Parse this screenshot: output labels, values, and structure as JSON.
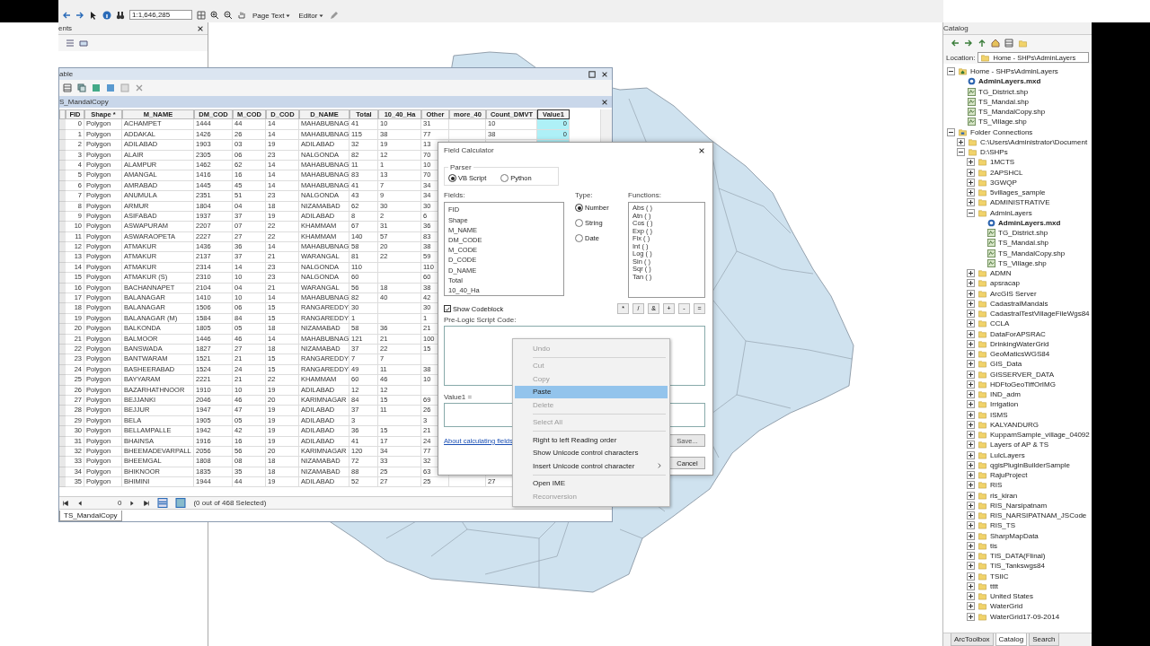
{
  "toolbar": {
    "scale": "1:1,646,285",
    "editor_menu": "Editor",
    "page_text_menu": "Page Text"
  },
  "toc": {
    "title": "ents"
  },
  "table_window": {
    "title": "able",
    "tab": "S_MandalCopy",
    "columns": [
      {
        "label": "FID",
        "selected": false
      },
      {
        "label": "Shape *",
        "selected": false
      },
      {
        "label": "M_NAME",
        "selected": false
      },
      {
        "label": "DM_COD",
        "selected": false
      },
      {
        "label": "M_COD",
        "selected": false
      },
      {
        "label": "D_COD",
        "selected": false
      },
      {
        "label": "D_NAME",
        "selected": false
      },
      {
        "label": "Total",
        "selected": false
      },
      {
        "label": "10_40_Ha",
        "selected": false
      },
      {
        "label": "Other",
        "selected": false
      },
      {
        "label": "more_40",
        "selected": false
      },
      {
        "label": "Count_DMVT",
        "selected": false
      },
      {
        "label": "Value1",
        "selected": true
      }
    ],
    "rows": [
      [
        "0",
        "Polygon",
        "ACHAMPET",
        "1444",
        "44",
        "14",
        "MAHABUBNAG",
        "41",
        "10",
        "31",
        null,
        "10",
        "0"
      ],
      [
        "1",
        "Polygon",
        "ADDAKAL",
        "1426",
        "26",
        "14",
        "MAHABUBNAG",
        "115",
        "38",
        "77",
        null,
        "38",
        "0"
      ],
      [
        "2",
        "Polygon",
        "ADILABAD",
        "1903",
        "03",
        "19",
        "ADILABAD",
        "32",
        "19",
        "13"
      ],
      [
        "3",
        "Polygon",
        "ALAIR",
        "2305",
        "06",
        "23",
        "NALGONDA",
        "82",
        "12",
        "70"
      ],
      [
        "4",
        "Polygon",
        "ALAMPUR",
        "1462",
        "62",
        "14",
        "MAHABUBNAG",
        "11",
        "1",
        "10"
      ],
      [
        "5",
        "Polygon",
        "AMANGAL",
        "1416",
        "16",
        "14",
        "MAHABUBNAG",
        "83",
        "13",
        "70"
      ],
      [
        "6",
        "Polygon",
        "AMRABAD",
        "1445",
        "45",
        "14",
        "MAHABUBNAG",
        "41",
        "7",
        "34"
      ],
      [
        "7",
        "Polygon",
        "ANUMULA",
        "2351",
        "51",
        "23",
        "NALGONDA",
        "43",
        "9",
        "34"
      ],
      [
        "8",
        "Polygon",
        "ARMUR",
        "1804",
        "04",
        "18",
        "NIZAMABAD",
        "62",
        "30",
        "30"
      ],
      [
        "9",
        "Polygon",
        "ASIFABAD",
        "1937",
        "37",
        "19",
        "ADILABAD",
        "8",
        "2",
        "6"
      ],
      [
        "10",
        "Polygon",
        "ASWAPURAM",
        "2207",
        "07",
        "22",
        "KHAMMAM",
        "67",
        "31",
        "36"
      ],
      [
        "11",
        "Polygon",
        "ASWARAOPETA",
        "2227",
        "27",
        "22",
        "KHAMMAM",
        "140",
        "57",
        "83"
      ],
      [
        "12",
        "Polygon",
        "ATMAKUR",
        "1436",
        "36",
        "14",
        "MAHABUBNAG",
        "58",
        "20",
        "38"
      ],
      [
        "13",
        "Polygon",
        "ATMAKUR",
        "2137",
        "37",
        "21",
        "WARANGAL",
        "81",
        "22",
        "59"
      ],
      [
        "14",
        "Polygon",
        "ATMAKUR",
        "2314",
        "14",
        "23",
        "NALGONDA",
        "110",
        null,
        "110"
      ],
      [
        "15",
        "Polygon",
        "ATMAKUR (S)",
        "2310",
        "10",
        "23",
        "NALGONDA",
        "60",
        null,
        "60"
      ],
      [
        "16",
        "Polygon",
        "BACHANNAPET",
        "2104",
        "04",
        "21",
        "WARANGAL",
        "56",
        "18",
        "38"
      ],
      [
        "17",
        "Polygon",
        "BALANAGAR",
        "1410",
        "10",
        "14",
        "MAHABUBNAG",
        "82",
        "40",
        "42"
      ],
      [
        "18",
        "Polygon",
        "BALANAGAR",
        "1506",
        "06",
        "15",
        "RANGAREDDY",
        "30",
        null,
        "30"
      ],
      [
        "19",
        "Polygon",
        "BALANAGAR (M)",
        "1584",
        "84",
        "15",
        "RANGAREDDY",
        "1",
        null,
        "1"
      ],
      [
        "20",
        "Polygon",
        "BALKONDA",
        "1805",
        "05",
        "18",
        "NIZAMABAD",
        "58",
        "36",
        "21"
      ],
      [
        "21",
        "Polygon",
        "BALMOOR",
        "1446",
        "46",
        "14",
        "MAHABUBNAG",
        "121",
        "21",
        "100"
      ],
      [
        "22",
        "Polygon",
        "BANSWADA",
        "1827",
        "27",
        "18",
        "NIZAMABAD",
        "37",
        "22",
        "15"
      ],
      [
        "23",
        "Polygon",
        "BANTWARAM",
        "1521",
        "21",
        "15",
        "RANGAREDDY",
        "7",
        "7",
        null
      ],
      [
        "24",
        "Polygon",
        "BASHEERABAD",
        "1524",
        "24",
        "15",
        "RANGAREDDY",
        "49",
        "11",
        "38"
      ],
      [
        "25",
        "Polygon",
        "BAYYARAM",
        "2221",
        "21",
        "22",
        "KHAMMAM",
        "60",
        "46",
        "10"
      ],
      [
        "26",
        "Polygon",
        "BAZARHATHNOOR",
        "1910",
        "10",
        "19",
        "ADILABAD",
        "12",
        "12",
        null
      ],
      [
        "27",
        "Polygon",
        "BEJJANKI",
        "2046",
        "46",
        "20",
        "KARIMNAGAR",
        "84",
        "15",
        "69"
      ],
      [
        "28",
        "Polygon",
        "BEJJUR",
        "1947",
        "47",
        "19",
        "ADILABAD",
        "37",
        "11",
        "26"
      ],
      [
        "29",
        "Polygon",
        "BELA",
        "1905",
        "05",
        "19",
        "ADILABAD",
        "3",
        null,
        "3"
      ],
      [
        "30",
        "Polygon",
        "BELLAMPALLE",
        "1942",
        "42",
        "19",
        "ADILABAD",
        "36",
        "15",
        "21"
      ],
      [
        "31",
        "Polygon",
        "BHAINSA",
        "1916",
        "16",
        "19",
        "ADILABAD",
        "41",
        "17",
        "24"
      ],
      [
        "32",
        "Polygon",
        "BHEEMADEVARPALL",
        "2056",
        "56",
        "20",
        "KARIMNAGAR",
        "120",
        "34",
        "77"
      ],
      [
        "33",
        "Polygon",
        "BHEEMGAL",
        "1808",
        "08",
        "18",
        "NIZAMABAD",
        "72",
        "33",
        "32"
      ],
      [
        "34",
        "Polygon",
        "BHIKNOOR",
        "1835",
        "35",
        "18",
        "NIZAMABAD",
        "88",
        "25",
        "63"
      ],
      [
        "35",
        "Polygon",
        "BHIMINI",
        "1944",
        "44",
        "19",
        "ADILABAD",
        "52",
        "27",
        "25",
        null,
        "27"
      ]
    ],
    "record": "0",
    "selection": "(0 out of 468 Selected)",
    "bottom_tab": "TS_MandalCopy"
  },
  "field_calculator": {
    "title": "Field Calculator",
    "parser_label": "Parser",
    "parsers": [
      {
        "label": "VB Script",
        "selected": true
      },
      {
        "label": "Python",
        "selected": false
      }
    ],
    "fields_label": "Fields:",
    "fields": [
      "FID",
      "Shape",
      "M_NAME",
      "DM_CODE",
      "M_CODE",
      "D_CODE",
      "D_NAME",
      "Total",
      "10_40_Ha"
    ],
    "type_label": "Type:",
    "types": [
      {
        "label": "Number",
        "selected": true
      },
      {
        "label": "String",
        "selected": false
      },
      {
        "label": "Date",
        "selected": false
      }
    ],
    "functions_label": "Functions:",
    "functions": [
      "Abs ( )",
      "Atn ( )",
      "Cos ( )",
      "Exp ( )",
      "Fix ( )",
      "Int ( )",
      "Log ( )",
      "Sin ( )",
      "Sqr ( )",
      "Tan ( )"
    ],
    "show_codeblock": {
      "label": "Show Codeblock",
      "checked": true
    },
    "operators": [
      "*",
      "/",
      "&",
      "+",
      "-",
      "="
    ],
    "prelogic_label": "Pre-Logic Script Code:",
    "expression_label": "Value1 =",
    "help_link": "About calculating fields",
    "save_button": "Save...",
    "cancel_button": "Cancel"
  },
  "context_menu": {
    "groups": [
      [
        {
          "label": "Undo",
          "disabled": true,
          "selected": false
        }
      ],
      [
        {
          "label": "Cut",
          "disabled": true,
          "selected": false
        },
        {
          "label": "Copy",
          "disabled": true,
          "selected": false
        },
        {
          "label": "Paste",
          "disabled": false,
          "selected": true
        },
        {
          "label": "Delete",
          "disabled": true,
          "selected": false
        }
      ],
      [
        {
          "label": "Select All",
          "disabled": true,
          "selected": false
        }
      ],
      [
        {
          "label": "Right to left Reading order",
          "disabled": false,
          "selected": false
        },
        {
          "label": "Show Unicode control characters",
          "disabled": false,
          "selected": false
        },
        {
          "label": "Insert Unicode control character",
          "disabled": false,
          "selected": false,
          "submenu": true
        }
      ],
      [
        {
          "label": "Open IME",
          "disabled": false,
          "selected": false
        },
        {
          "label": "Reconversion",
          "disabled": true,
          "selected": false
        }
      ]
    ]
  },
  "catalog": {
    "title": "Catalog",
    "location_label": "Location:",
    "location": "Home - SHPs\\AdminLayers",
    "tree": [
      {
        "label": "Home - SHPs\\AdminLayers",
        "kind": "home",
        "expanded": true,
        "children": [
          {
            "label": "AdminLayers.mxd",
            "kind": "mxd"
          },
          {
            "label": "TG_District.shp",
            "kind": "shp"
          },
          {
            "label": "TS_Mandal.shp",
            "kind": "shp"
          },
          {
            "label": "TS_MandalCopy.shp",
            "kind": "shp"
          },
          {
            "label": "TS_Village.shp",
            "kind": "shp"
          }
        ]
      },
      {
        "label": "Folder Connections",
        "kind": "connections",
        "expanded": true,
        "children": [
          {
            "label": "C:\\Users\\Administrator\\Document",
            "kind": "folder",
            "expanded": false
          },
          {
            "label": "D:\\SHPs",
            "kind": "folder",
            "expanded": true,
            "children": [
              {
                "label": "1MCTS",
                "kind": "folder",
                "expanded": false
              },
              {
                "label": "2APSHCL",
                "kind": "folder",
                "expanded": false
              },
              {
                "label": "3GWQP",
                "kind": "folder",
                "expanded": false
              },
              {
                "label": "5villages_sample",
                "kind": "folder",
                "expanded": false
              },
              {
                "label": "ADMINISTRATIVE",
                "kind": "folder",
                "expanded": false
              },
              {
                "label": "AdminLayers",
                "kind": "folder",
                "expanded": true,
                "children": [
                  {
                    "label": "AdminLayers.mxd",
                    "kind": "mxd"
                  },
                  {
                    "label": "TG_District.shp",
                    "kind": "shp"
                  },
                  {
                    "label": "TS_Mandal.shp",
                    "kind": "shp"
                  },
                  {
                    "label": "TS_MandalCopy.shp",
                    "kind": "shp"
                  },
                  {
                    "label": "TS_Village.shp",
                    "kind": "shp"
                  }
                ]
              },
              {
                "label": "ADMN",
                "kind": "folder",
                "expanded": false
              },
              {
                "label": "apsracap",
                "kind": "folder",
                "expanded": false
              },
              {
                "label": "ArcGIS Server",
                "kind": "folder",
                "expanded": false
              },
              {
                "label": "CadastralMandals",
                "kind": "folder",
                "expanded": false
              },
              {
                "label": "CadastralTestVillageFileWgs84",
                "kind": "folder",
                "expanded": false
              },
              {
                "label": "CCLA",
                "kind": "folder",
                "expanded": false
              },
              {
                "label": "DataForAPSRAC",
                "kind": "folder",
                "expanded": false
              },
              {
                "label": "DrinkingWaterGrid",
                "kind": "folder",
                "expanded": false
              },
              {
                "label": "GeoMaticsWGS84",
                "kind": "folder",
                "expanded": false
              },
              {
                "label": "GIS_Data",
                "kind": "folder",
                "expanded": false
              },
              {
                "label": "GISSERVER_DATA",
                "kind": "folder",
                "expanded": false
              },
              {
                "label": "HDFtoGeoTiffOrIMG",
                "kind": "folder",
                "expanded": false
              },
              {
                "label": "IND_adm",
                "kind": "folder",
                "expanded": false
              },
              {
                "label": "Irrigation",
                "kind": "folder",
                "expanded": false
              },
              {
                "label": "ISMS",
                "kind": "folder",
                "expanded": false
              },
              {
                "label": "KALYANDURG",
                "kind": "folder",
                "expanded": false
              },
              {
                "label": "KuppamSample_village_04092",
                "kind": "folder",
                "expanded": false
              },
              {
                "label": "Layers of AP & TS",
                "kind": "folder",
                "expanded": false
              },
              {
                "label": "LulcLayers",
                "kind": "folder",
                "expanded": false
              },
              {
                "label": "qgisPluginBuilderSample",
                "kind": "folder",
                "expanded": false
              },
              {
                "label": "RajuProject",
                "kind": "folder",
                "expanded": false
              },
              {
                "label": "RIS",
                "kind": "folder",
                "expanded": false
              },
              {
                "label": "ris_kiran",
                "kind": "folder",
                "expanded": false
              },
              {
                "label": "RIS_Narsipatnam",
                "kind": "folder",
                "expanded": false
              },
              {
                "label": "RIS_NARSIPATNAM_JSCode",
                "kind": "folder",
                "expanded": false
              },
              {
                "label": "RIS_TS",
                "kind": "folder",
                "expanded": false
              },
              {
                "label": "SharpMapData",
                "kind": "folder",
                "expanded": false
              },
              {
                "label": "tis",
                "kind": "folder",
                "expanded": false
              },
              {
                "label": "TIS_DATA(Flinal)",
                "kind": "folder",
                "expanded": false
              },
              {
                "label": "TIS_Tankswgs84",
                "kind": "folder",
                "expanded": false
              },
              {
                "label": "TSIIC",
                "kind": "folder",
                "expanded": false
              },
              {
                "label": "tttt",
                "kind": "folder",
                "expanded": false
              },
              {
                "label": "United States",
                "kind": "folder",
                "expanded": false
              },
              {
                "label": "WaterGrid",
                "kind": "folder",
                "expanded": false
              },
              {
                "label": "WaterGrid17-09-2014",
                "kind": "folder",
                "expanded": false
              }
            ]
          }
        ]
      }
    ],
    "bottom_tabs": [
      {
        "label": "ArcToolbox",
        "selected": false
      },
      {
        "label": "Catalog",
        "selected": true
      },
      {
        "label": "Search",
        "selected": false
      }
    ]
  }
}
